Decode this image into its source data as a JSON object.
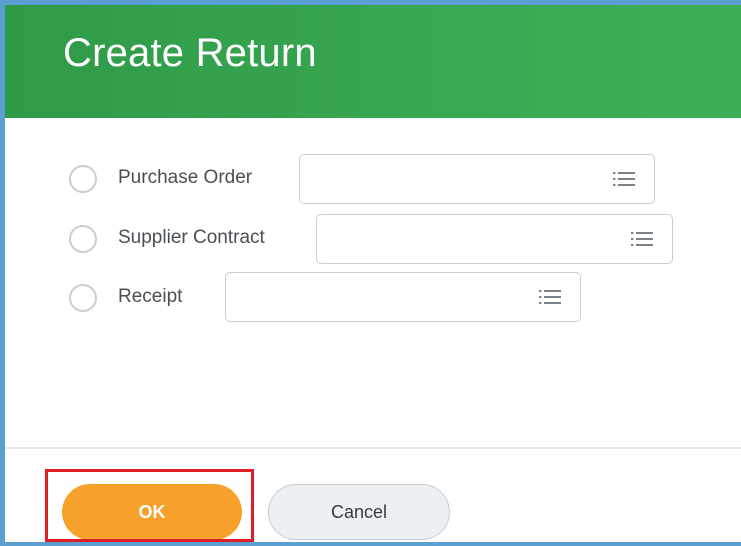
{
  "dialog": {
    "title": "Create Return",
    "options": [
      {
        "label": "Purchase Order",
        "value": "",
        "icon": "list-icon",
        "selected": false
      },
      {
        "label": "Supplier Contract",
        "value": "",
        "icon": "list-icon",
        "selected": false
      },
      {
        "label": "Receipt",
        "value": "",
        "icon": "list-icon",
        "selected": false
      }
    ]
  },
  "buttons": {
    "ok_label": "OK",
    "cancel_label": "Cancel"
  },
  "colors": {
    "header": "#38a852",
    "ok_button": "#f7a02a",
    "highlight_border": "#e01e26",
    "frame": "#5a9fd0"
  }
}
